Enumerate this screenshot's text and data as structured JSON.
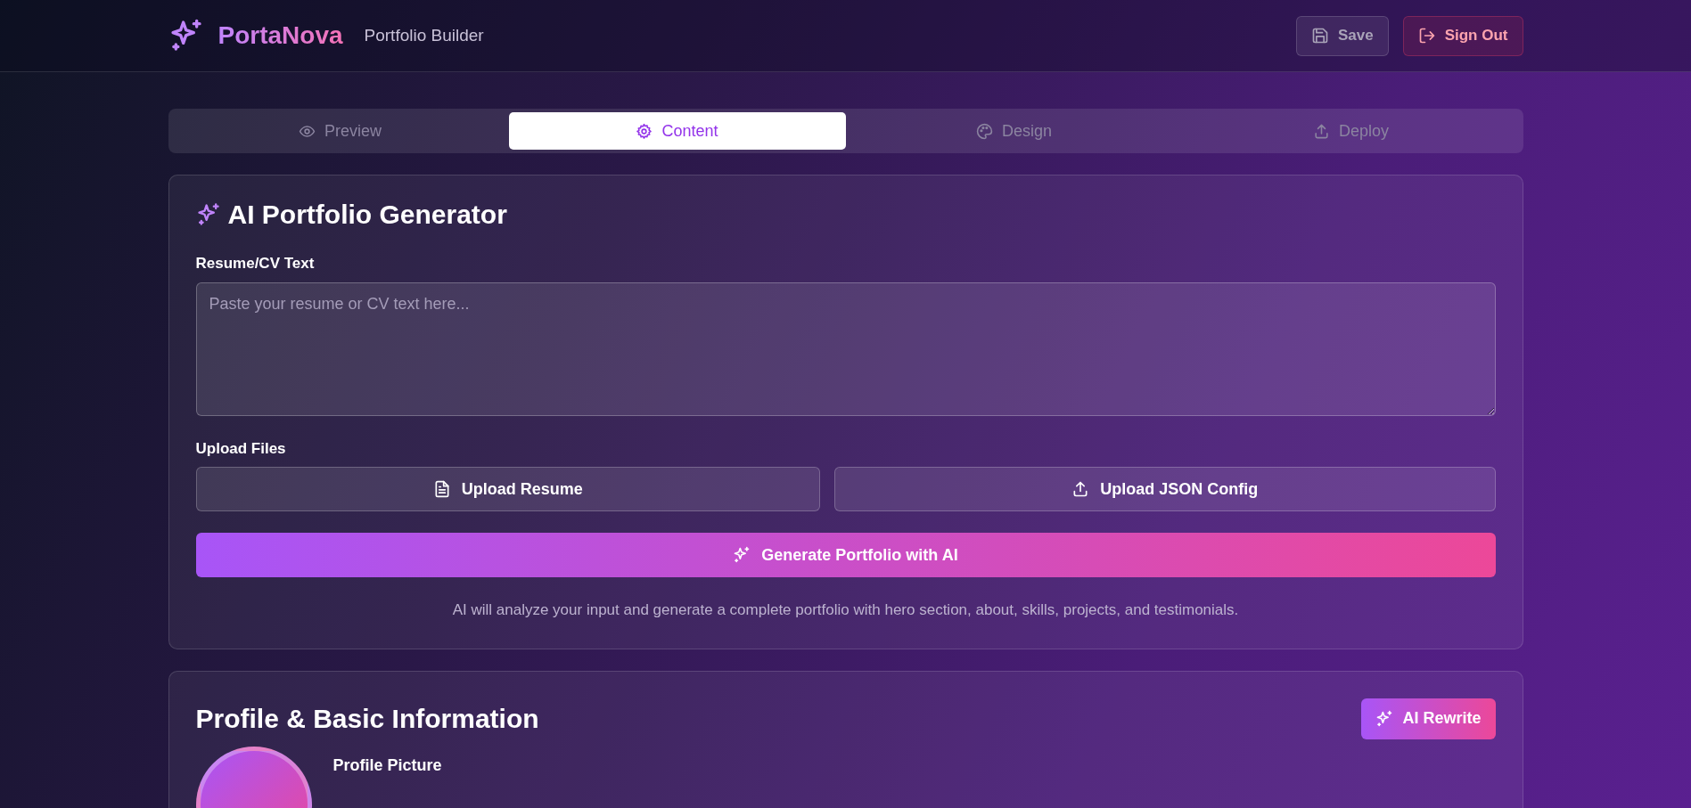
{
  "header": {
    "logo": "PortaNova",
    "subtitle": "Portfolio Builder",
    "buttons": [
      {
        "kind": "save",
        "label": "Save"
      },
      {
        "kind": "signout",
        "label": "Sign Out"
      }
    ]
  },
  "tabs": [
    {
      "kind": "eye",
      "label": "Preview",
      "selected": false
    },
    {
      "kind": "gear",
      "label": "Content",
      "selected": true
    },
    {
      "kind": "palette",
      "label": "Design",
      "selected": false
    },
    {
      "kind": "upload",
      "label": "Deploy",
      "selected": false
    }
  ],
  "generator": {
    "title": "AI Portfolio Generator",
    "resume_label": "Resume/CV Text",
    "resume_placeholder": "Paste your resume or CV text here...",
    "upload_label": "Upload Files",
    "uploads": [
      {
        "kind": "file",
        "label": "Upload Resume"
      },
      {
        "kind": "upload",
        "label": "Upload JSON Config"
      }
    ],
    "generate_button": "Generate Portfolio with AI",
    "note": "AI will analyze your input and generate a complete portfolio with hero section, about, skills, projects, and testimonials."
  },
  "profile": {
    "title": "Profile & Basic Information",
    "rewrite_button": "AI Rewrite",
    "picture_label": "Profile Picture"
  }
}
